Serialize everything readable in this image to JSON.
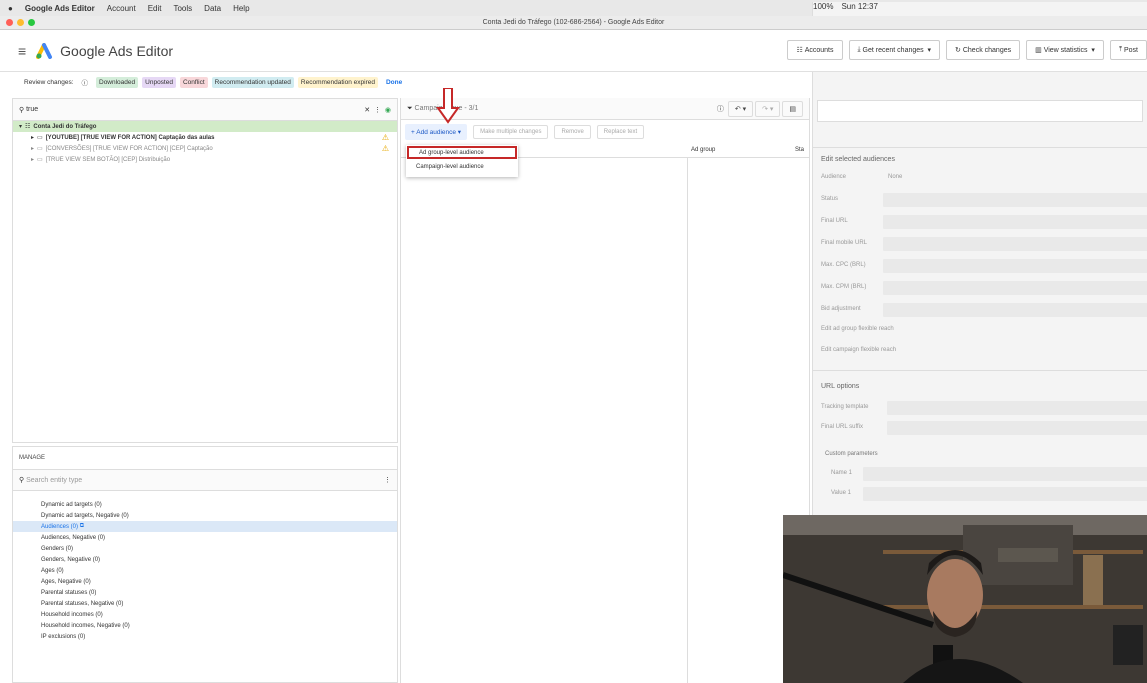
{
  "menubar": {
    "app": "Google Ads Editor",
    "items": [
      "Account",
      "Edit",
      "Tools",
      "Data",
      "Help"
    ],
    "clock": "Sun 12:37",
    "battery": "100%"
  },
  "window": {
    "title": "Conta Jedi do Tráfego (102-686-2564) - Google Ads Editor"
  },
  "header": {
    "app_name": "Google Ads Editor",
    "buttons": [
      "Accounts",
      "Get recent changes",
      "Check changes",
      "View statistics",
      "Post"
    ]
  },
  "review": {
    "label": "Review changes:",
    "chips": [
      {
        "label": "Downloaded",
        "bg": "#d4edda"
      },
      {
        "label": "Unposted",
        "bg": "#e6d8f5"
      },
      {
        "label": "Conflict",
        "bg": "#f8d7da"
      },
      {
        "label": "Recommendation updated",
        "bg": "#d1ecf1"
      },
      {
        "label": "Recommendation expired",
        "bg": "#fff3cd"
      }
    ],
    "done": "Done"
  },
  "left": {
    "search_value": "true",
    "tree": [
      {
        "label": "Conta Jedi do Tráfego",
        "sel": true
      },
      {
        "label": "[YOUTUBE] [TRUE VIEW FOR ACTION] Captação das aulas",
        "warn": true
      },
      {
        "label": "[CONVERSÕES] [TRUE VIEW FOR ACTION] [CEP] Captação",
        "warn": true
      },
      {
        "label": "[TRUE VIEW SEM BOTÃO] [CEP] Distribuição"
      }
    ]
  },
  "manage": {
    "label": "MANAGE",
    "search_placeholder": "Search entity type",
    "items": [
      "Dynamic ad targets (0)",
      "Dynamic ad targets, Negative (0)",
      "Audiences (0)",
      "Audiences, Negative (0)",
      "Genders (0)",
      "Genders, Negative (0)",
      "Ages (0)",
      "Ages, Negative (0)",
      "Parental statuses (0)",
      "Parental statuses, Negative (0)",
      "Household incomes (0)",
      "Household incomes, Negative (0)",
      "IP exclusions (0)"
    ],
    "selected_index": 2
  },
  "center": {
    "filter": "Campaign: true - 3/1",
    "add_audience": "+ Add audience",
    "buttons": [
      "Make multiple changes",
      "Remove",
      "Replace text"
    ],
    "col_adgroup": "Ad group",
    "col_status": "Sta"
  },
  "dropdown": {
    "items": [
      "Ad group-level audience",
      "Campaign-level audience"
    ]
  },
  "right": {
    "title": "Edit selected audiences",
    "audience_label": "Audience",
    "audience_value": "None",
    "fields": [
      "Status",
      "Final URL",
      "Final mobile URL",
      "Max. CPC (BRL)",
      "Max. CPM (BRL)",
      "Bid adjustment"
    ],
    "links": [
      "Edit ad group flexible reach",
      "Edit campaign flexible reach"
    ],
    "url_options": "URL options",
    "url_fields": [
      "Tracking template",
      "Final URL suffix"
    ],
    "custom_params": "Custom parameters",
    "param_fields": [
      "Name 1",
      "Value 1"
    ]
  }
}
